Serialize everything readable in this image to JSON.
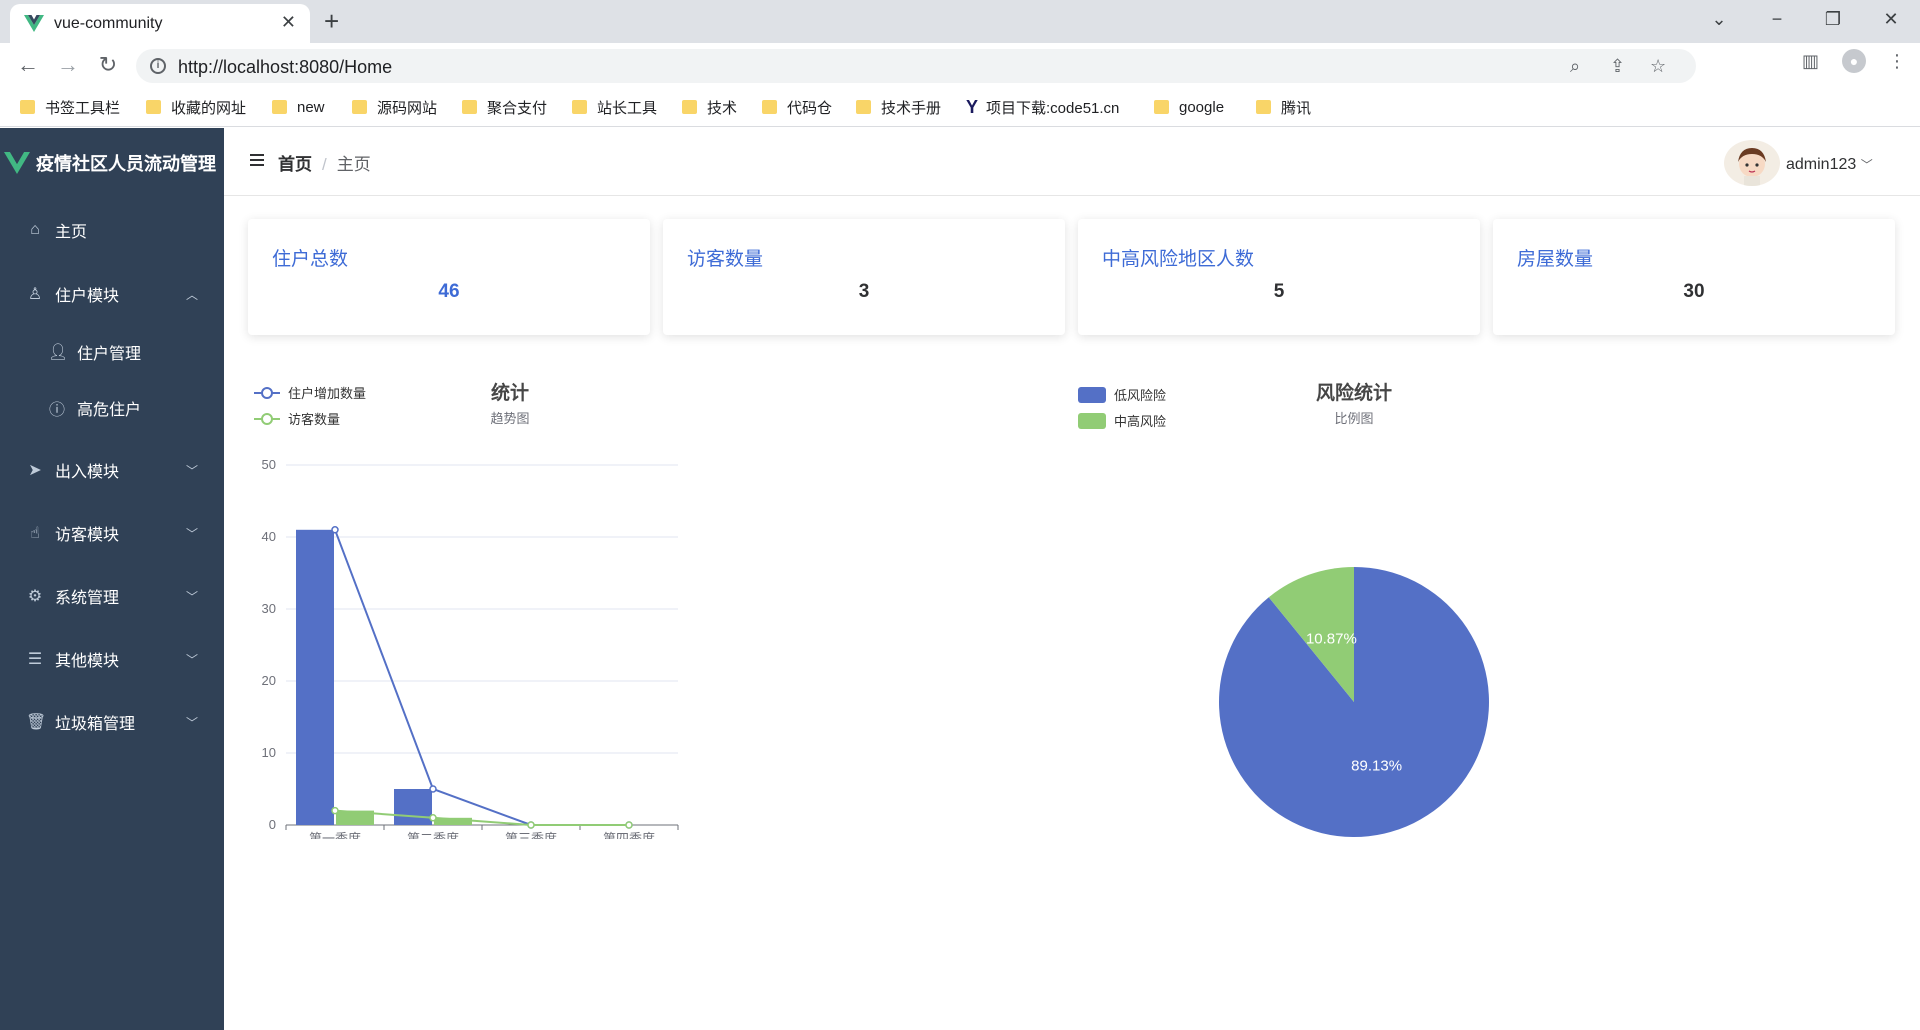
{
  "browser": {
    "tab_title": "vue-community",
    "new_tab": "+",
    "url": "http://localhost:8080/Home",
    "bookmarks": [
      "书签工具栏",
      "收藏的网址",
      "new",
      "源码网站",
      "聚合支付",
      "站长工具",
      "技术",
      "代码仓",
      "技术手册",
      "项目下载:code51.cn",
      "google",
      "腾讯"
    ]
  },
  "app": {
    "title": "疫情社区人员流动管理",
    "menu": {
      "home": "主页",
      "resident_module": "住户模块",
      "resident_manage": "住户管理",
      "high_risk_resident": "高危住户",
      "access_module": "出入模块",
      "visitor_module": "访客模块",
      "system_manage": "系统管理",
      "other_module": "其他模块",
      "trash_manage": "垃圾箱管理"
    }
  },
  "header": {
    "breadcrumb_home": "首页",
    "breadcrumb_sep": "/",
    "breadcrumb_current": "主页",
    "username": "admin123"
  },
  "cards": [
    {
      "title": "住户总数",
      "value": "46"
    },
    {
      "title": "访客数量",
      "value": "3"
    },
    {
      "title": "中高风险地区人数",
      "value": "5"
    },
    {
      "title": "房屋数量",
      "value": "30"
    }
  ],
  "colors": {
    "blue": "#5470c6",
    "green": "#91cc75",
    "sidebar": "#304156",
    "accent": "#3e6bd6"
  },
  "chart_data": [
    {
      "type": "bar",
      "title": "统计",
      "subtitle": "趋势图",
      "categories": [
        "第一季度",
        "第二季度",
        "第三季度",
        "第四季度"
      ],
      "series": [
        {
          "name": "住户增加数量",
          "bar_values": [
            41,
            5,
            0,
            0
          ],
          "line_values": [
            41,
            5,
            0,
            0
          ]
        },
        {
          "name": "访客数量",
          "bar_values": [
            2,
            1,
            0,
            0
          ],
          "line_values": [
            2,
            1,
            0,
            0
          ]
        }
      ],
      "y_ticks": [
        "0",
        "10",
        "20",
        "30",
        "40",
        "50"
      ],
      "ylim": [
        0,
        50
      ],
      "grid": true,
      "legend": "top-left"
    },
    {
      "type": "pie",
      "title": "风险统计",
      "subtitle": "比例图",
      "slices": [
        {
          "name": "低风险险",
          "value": 89.13,
          "label": "89.13%"
        },
        {
          "name": "中高风险",
          "value": 10.87,
          "label": "10.87%"
        }
      ],
      "legend": "top-left"
    }
  ]
}
